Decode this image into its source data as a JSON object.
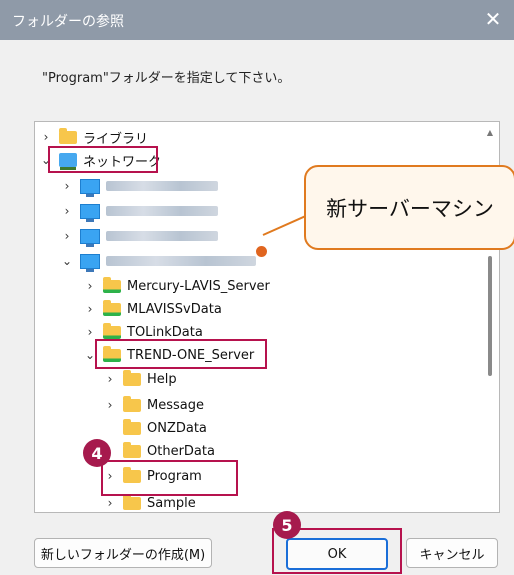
{
  "dialog": {
    "title": "フォルダーの参照",
    "close_glyph": "✕",
    "instruction": "\"Program\"フォルダーを指定して下さい。"
  },
  "tree": {
    "libraries": "ライブラリ",
    "network": "ネットワーク",
    "servers": [
      "Mercury-LAVIS_Server",
      "MLAVISSvData",
      "TOLinkData",
      "TREND-ONE_Server"
    ],
    "trend_children": [
      "Help",
      "Message",
      "ONZData",
      "OtherData",
      "Program",
      "Sample"
    ]
  },
  "buttons": {
    "new_folder": "新しいフォルダーの作成(M)",
    "ok": "OK",
    "cancel": "キャンセル"
  },
  "annotations": {
    "callout": "新サーバーマシン",
    "step4": "4",
    "step5": "5"
  },
  "colors": {
    "titlebar": "#8f9aa8",
    "highlight": "#b6124d",
    "badge": "#a61a4d",
    "callout_border": "#e07a1f"
  }
}
